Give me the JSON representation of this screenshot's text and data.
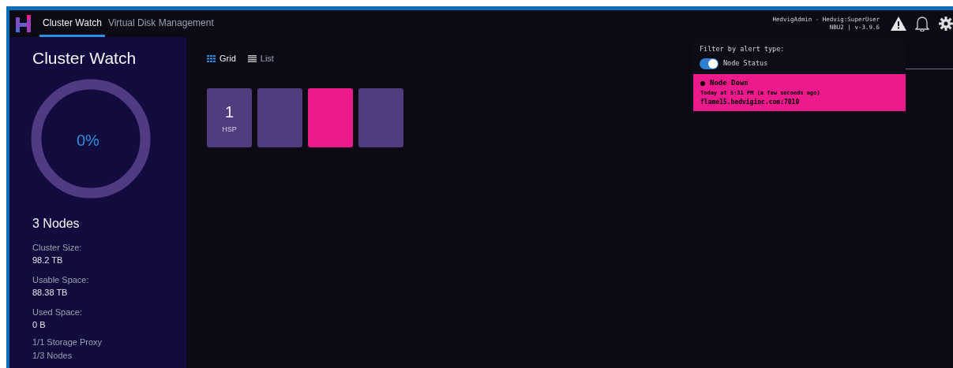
{
  "header": {
    "tabs": [
      {
        "label": "Cluster Watch",
        "selected": true
      },
      {
        "label": "Virtual Disk Management",
        "selected": false
      }
    ],
    "user": "HedvigAdmin - Hedvig:SuperUser",
    "cluster": "NBU2 | v-3.9.6"
  },
  "sidebar": {
    "title": "Cluster Watch",
    "gauge_label": "0%",
    "nodes": "3 Nodes",
    "stats": [
      {
        "label": "Cluster Size:",
        "value": "98.2 TB"
      },
      {
        "label": "Usable Space:",
        "value": "88.38 TB"
      },
      {
        "label": "Used Space:",
        "value": "0 B"
      }
    ],
    "footer": [
      "1/1 Storage Proxy",
      "1/3 Nodes"
    ]
  },
  "views": [
    {
      "label": "Grid",
      "selected": true
    },
    {
      "label": "List",
      "selected": false
    }
  ],
  "tiles": [
    {
      "kind": "proxy",
      "number": "1",
      "caption": "HSP",
      "color": "#523c80"
    },
    {
      "kind": "node",
      "color": "#523c80"
    },
    {
      "kind": "node",
      "color": "#ec1a8c"
    },
    {
      "kind": "node",
      "color": "#523c80"
    }
  ],
  "alerts_popup": {
    "heading": "Filter by alert type:",
    "filters": [
      {
        "label": "Node Status",
        "on": true
      }
    ],
    "alerts": [
      {
        "title": "Node Down",
        "time": "Today at 5:31 PM (a few seconds ago)",
        "host": "flame15.hedviginc.com:7010",
        "color": "#ec1a8c"
      }
    ]
  }
}
